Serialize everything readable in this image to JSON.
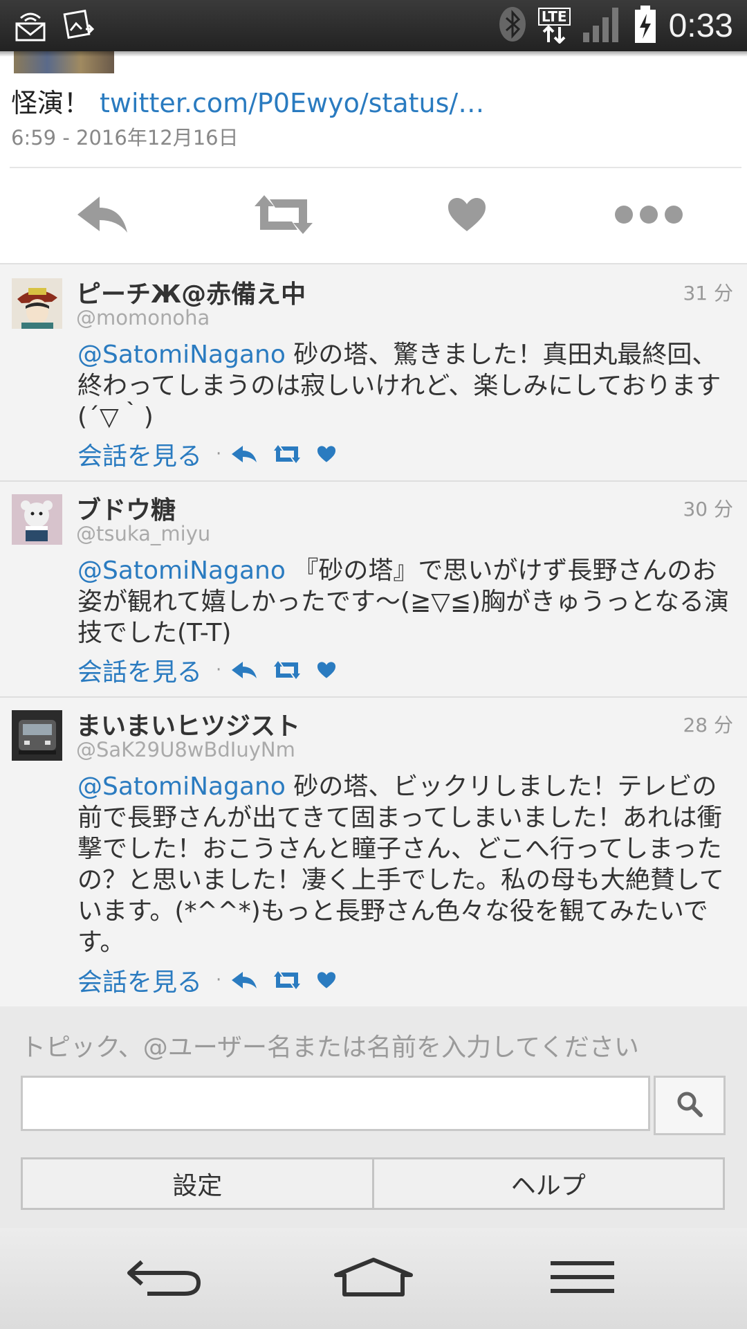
{
  "status_bar": {
    "network_label": "LTE",
    "time": "0:33",
    "icons": [
      "satellite-dish-icon",
      "photo-upload-icon",
      "bluetooth-icon",
      "lte-icon",
      "signal-icon",
      "battery-charging-icon"
    ]
  },
  "tweet": {
    "text": "怪演！",
    "link": "twitter.com/P0Ewyo/status/…",
    "date": "6:59 - 2016年12月16日"
  },
  "actions": [
    "reply-icon",
    "retweet-icon",
    "like-icon",
    "more-icon"
  ],
  "replies": [
    {
      "name": "ピーチЖ@赤備え中",
      "handle": "@momonoha",
      "time": "31 分",
      "mention": "@SatomiNagano",
      "text": " 砂の塔、驚きました！真田丸最終回、終わってしまうのは寂しいけれど、楽しみにしております(´▽｀)",
      "conversation": "会話を見る"
    },
    {
      "name": "ブドウ糖",
      "handle": "@tsuka_miyu",
      "time": "30 分",
      "mention": "@SatomiNagano",
      "text": " 『砂の塔』で思いがけず長野さんのお姿が観れて嬉しかったです～(≧▽≦)胸がきゅうっとなる演技でした(T-T)",
      "conversation": "会話を見る"
    },
    {
      "name": "まいまいヒツジスト",
      "handle": "@SaK29U8wBdIuyNm",
      "time": "28 分",
      "mention": "@SatomiNagano",
      "text": " 砂の塔、ビックリしました！テレビの前で長野さんが出てきて固まってしまいました！あれは衝撃でした！おこうさんと瞳子さん、どこへ行ってしまったの？と思いました！凄く上手でした。私の母も大絶賛しています。(*^^*)もっと長野さん色々な役を観てみたいです。",
      "conversation": "会話を見る"
    }
  ],
  "search": {
    "hint": "トピック、@ユーザー名または名前を入力してください",
    "value": "",
    "placeholder": ""
  },
  "buttons": {
    "settings": "設定",
    "help": "ヘルプ"
  },
  "colors": {
    "link": "#2a7bc0",
    "icon_gray": "#9b9b9b"
  }
}
